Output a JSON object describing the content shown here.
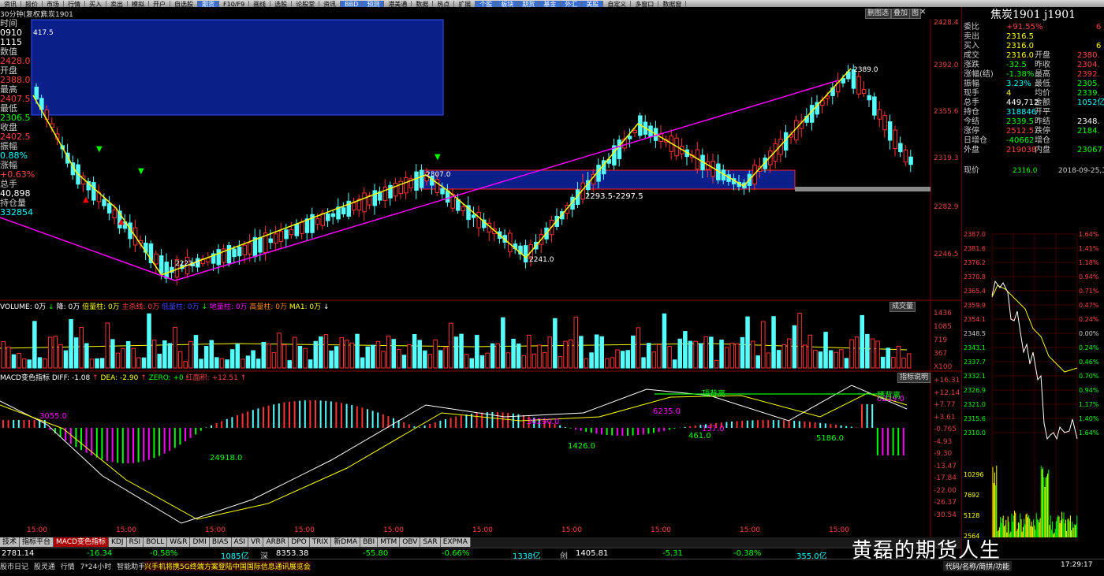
{
  "menu": [
    "资讯",
    "报价",
    "市场",
    "行情",
    "买入",
    "卖出",
    "模拟",
    "开户",
    "自选股",
    "期货",
    "F10/F9",
    "画线",
    "选股",
    "论股堂",
    "资讯",
    "BBD",
    "预测",
    "港美通",
    "数据",
    "热点",
    "扩展",
    "个股",
    "板块",
    "期货",
    "基金",
    "外汇",
    "美股",
    "自定义",
    "多窗口",
    "数据窗"
  ],
  "menu_blue": [
    "BBD",
    "预测",
    "个股",
    "板块",
    "期货",
    "基金",
    "外汇",
    "美股"
  ],
  "header": {
    "tab1": "30分钟(复权)",
    "tab2": "焦炭1901",
    "btn_main": "删图选",
    "btn_overlay": "叠加",
    "icon_menu": "图"
  },
  "left_info": [
    {
      "t": "时间",
      "c": "#ccc"
    },
    {
      "t": "0910",
      "c": "#fff"
    },
    {
      "t": "1115",
      "c": "#fff"
    },
    {
      "t": "数值",
      "c": "#ccc"
    },
    {
      "t": "2428.0",
      "c": "#f44"
    },
    {
      "t": "开盘",
      "c": "#ccc"
    },
    {
      "t": "2388.0",
      "c": "#f44"
    },
    {
      "t": "最高",
      "c": "#ccc"
    },
    {
      "t": "2407.5",
      "c": "#f44"
    },
    {
      "t": "最低",
      "c": "#ccc"
    },
    {
      "t": "2306.5",
      "c": "#0f0"
    },
    {
      "t": "收盘",
      "c": "#ccc"
    },
    {
      "t": "2402.5",
      "c": "#f44"
    },
    {
      "t": "振幅",
      "c": "#ccc"
    },
    {
      "t": "0.88%",
      "c": "#0ff"
    },
    {
      "t": "涨幅",
      "c": "#ccc"
    },
    {
      "t": "+0.63%",
      "c": "#f44"
    },
    {
      "t": "总手",
      "c": "#ccc"
    },
    {
      "t": "40,898",
      "c": "#fff"
    },
    {
      "t": "持仓量",
      "c": "#ccc"
    },
    {
      "t": "332854",
      "c": "#0ff"
    }
  ],
  "price_axis": [
    "2428.4",
    "2392.0",
    "2355.6",
    "2319.3",
    "2282.9",
    "2246.5"
  ],
  "annotations": {
    "high_box_label": "417.5",
    "low1": "2221.0",
    "peak1": "2307.0",
    "range": "2293.5-2297.5",
    "low2": "2241.0",
    "peak2": "2389.0"
  },
  "volume": {
    "header": [
      {
        "t": "VOLUME: 0万",
        "c": "#fff"
      },
      {
        "t": "↓",
        "c": "#0f0"
      },
      {
        "t": "降: 0万",
        "c": "#fff"
      },
      {
        "t": "倍量柱: 0万",
        "c": "#ff0"
      },
      {
        "t": "主杀线: 0万",
        "c": "#f44"
      },
      {
        "t": "低量柱: 0万",
        "c": "#44f"
      },
      {
        "t": "↓",
        "c": "#0f0"
      },
      {
        "t": "地量柱: 0万",
        "c": "#f0f"
      },
      {
        "t": "高量柱: 0万",
        "c": "#f80"
      },
      {
        "t": "MA1: 0万",
        "c": "#ff0"
      },
      {
        "t": "↓",
        "c": "#fff"
      }
    ],
    "btn": "成交量",
    "axis": [
      "1436",
      "1085",
      "719",
      "367",
      "X100"
    ],
    "tag": "倍"
  },
  "macd": {
    "header": [
      {
        "t": "MACD变色指标",
        "c": "#fff"
      },
      {
        "t": "DIFF: -1.08",
        "c": "#fff"
      },
      {
        "t": "↑",
        "c": "#f44"
      },
      {
        "t": "DEA: -2.90",
        "c": "#ff0"
      },
      {
        "t": "↑",
        "c": "#f44"
      },
      {
        "t": "ZERO: +0",
        "c": "#0f0"
      },
      {
        "t": "红面积: +12.51",
        "c": "#f44"
      },
      {
        "t": "↑",
        "c": "#f44"
      }
    ],
    "btn": "指标说明",
    "axis": [
      "+16.31",
      "+12.14",
      "+7.77",
      "+3.61",
      "-0.765",
      "-4.93",
      "-9.30",
      "-13.47",
      "-17.84",
      "-22.00",
      "-26.37",
      "-30.54"
    ],
    "labels": {
      "a": "3055.0",
      "b": "24918.0",
      "c": "30290.0",
      "d": "1426.0",
      "e": "6235.0",
      "f": "461.0",
      "g": "157.0",
      "h": "5186.0",
      "i": "6239.0",
      "top1": "顶背离",
      "top2": "顶背离"
    }
  },
  "time_ticks": [
    "15:00",
    "15:00",
    "15:00",
    "15:00",
    "15:00",
    "15:00",
    "15:00",
    "15:00",
    "15:00",
    "15:00"
  ],
  "tabs": [
    "技术",
    "指标平台",
    "MACD变色指标",
    "KDJ",
    "RSI",
    "BOLL",
    "W&R",
    "DMI",
    "BIAS",
    "ASI",
    "VR",
    "ARBR",
    "DPO",
    "TRIX",
    "新DMA",
    "BBI",
    "MTM",
    "OBV",
    "SAR",
    "EXPMA"
  ],
  "index_bar": [
    {
      "t": "2781.14",
      "c": "#fff"
    },
    {
      "t": "-16.34",
      "c": "#0f0"
    },
    {
      "t": "-0.58%",
      "c": "#0f0"
    },
    {
      "t": "1085亿",
      "c": "#0ff"
    },
    {
      "t": "深",
      "c": "#ccc"
    },
    {
      "t": "8353.38",
      "c": "#fff"
    },
    {
      "t": "-55.80",
      "c": "#0f0"
    },
    {
      "t": "-0.66%",
      "c": "#0f0"
    },
    {
      "t": "1338亿",
      "c": "#0ff"
    },
    {
      "t": "创",
      "c": "#ccc"
    },
    {
      "t": "1405.81",
      "c": "#fff"
    },
    {
      "t": "-5.31",
      "c": "#0f0"
    },
    {
      "t": "-0.38%",
      "c": "#0f0"
    },
    {
      "t": "355.0亿",
      "c": "#0ff"
    }
  ],
  "status": {
    "items": [
      "股市日记",
      "股灵通",
      "行情",
      "7*24小时",
      "智能助手"
    ],
    "news": "兴手机将携5G终端方案登陆中国国际信息通讯展览会",
    "search_hint": "代码/名称/简拼/功能",
    "clock": "17:29:17"
  },
  "quote": {
    "title": "焦炭1901 j1901",
    "rows": [
      [
        {
          "t": "委比",
          "c": "#ccc"
        },
        {
          "t": "+91.55%",
          "c": "#f44"
        },
        {
          "t": "6",
          "c": "#f44"
        }
      ],
      [
        {
          "t": "卖出",
          "c": "#ccc"
        },
        {
          "t": "2316.5",
          "c": "#ff0"
        }
      ],
      [
        {
          "t": "买入",
          "c": "#ccc"
        },
        {
          "t": "2316.0",
          "c": "#ff0"
        },
        {
          "t": "6",
          "c": "#ff0"
        }
      ],
      [
        {
          "t": "成交",
          "c": "#ccc"
        },
        {
          "t": "2316.0",
          "c": "#ff0"
        },
        {
          "t": "开盘",
          "c": "#ccc"
        },
        {
          "t": "2380.",
          "c": "#f44"
        }
      ],
      [
        {
          "t": "涨跌",
          "c": "#ccc"
        },
        {
          "t": "-32.5",
          "c": "#0f0"
        },
        {
          "t": "昨收",
          "c": "#ccc"
        },
        {
          "t": "2304.",
          "c": "#f44"
        }
      ],
      [
        {
          "t": "涨幅(结)",
          "c": "#ccc"
        },
        {
          "t": "-1.38%",
          "c": "#0f0"
        },
        {
          "t": "最高",
          "c": "#ccc"
        },
        {
          "t": "2392.",
          "c": "#f44"
        }
      ],
      [
        {
          "t": "振幅",
          "c": "#ccc"
        },
        {
          "t": "3.23%",
          "c": "#0ff"
        },
        {
          "t": "最低",
          "c": "#ccc"
        },
        {
          "t": "2305.",
          "c": "#0f0"
        }
      ],
      [
        {
          "t": "现手",
          "c": "#ccc"
        },
        {
          "t": "4",
          "c": "#ff0"
        },
        {
          "t": "均价",
          "c": "#ccc"
        },
        {
          "t": "2339.",
          "c": "#0f0"
        }
      ],
      [
        {
          "t": "总手",
          "c": "#ccc"
        },
        {
          "t": "449,712",
          "c": "#fff"
        },
        {
          "t": "金额",
          "c": "#ccc"
        },
        {
          "t": "1052亿",
          "c": "#0ff"
        }
      ],
      [
        {
          "t": "持仓",
          "c": "#ccc"
        },
        {
          "t": "318846",
          "c": "#0ff"
        },
        {
          "t": "开平",
          "c": "#ccc"
        },
        {
          "t": "",
          "c": "#fff"
        }
      ],
      [
        {
          "t": "今结",
          "c": "#ccc"
        },
        {
          "t": "2339.5",
          "c": "#0f0"
        },
        {
          "t": "昨结",
          "c": "#ccc"
        },
        {
          "t": "2348.",
          "c": "#fff"
        }
      ],
      [
        {
          "t": "涨停",
          "c": "#ccc"
        },
        {
          "t": "2512.5",
          "c": "#f44"
        },
        {
          "t": "跌停",
          "c": "#ccc"
        },
        {
          "t": "2184.",
          "c": "#0f0"
        }
      ],
      [
        {
          "t": "日增仓",
          "c": "#ccc"
        },
        {
          "t": "-40662",
          "c": "#0f0"
        },
        {
          "t": "增仓",
          "c": "#ccc"
        },
        {
          "t": "",
          "c": "#fff"
        }
      ],
      [
        {
          "t": "外盘",
          "c": "#ccc"
        },
        {
          "t": "219038",
          "c": "#f44"
        },
        {
          "t": "内盘",
          "c": "#ccc"
        },
        {
          "t": "23067",
          "c": "#0f0"
        }
      ]
    ],
    "now_label": "现价",
    "now_price": "2316.0",
    "now_date": "2018-09-25,二",
    "mini_left": [
      "2387.0",
      "2381.6",
      "2376.2",
      "2370.8",
      "2365.4",
      "2359.9",
      "2354.1",
      "2348.5",
      "2343.1",
      "2337.7",
      "2332.1",
      "2326.9",
      "2321.0",
      "2315.6",
      "2310.0"
    ],
    "mini_right": [
      "1.64%",
      "1.41%",
      "1.18%",
      "0.94%",
      "0.71%",
      "0.47%",
      "0.24%",
      "0.00%",
      "0.24%",
      "0.46%",
      "0.70%",
      "0.94%",
      "1.17%",
      "1.40%",
      "1.64%"
    ],
    "mini_vol": [
      "10296",
      "7692",
      "5128",
      "2564"
    ]
  },
  "watermark": "黄磊的期货人生"
}
